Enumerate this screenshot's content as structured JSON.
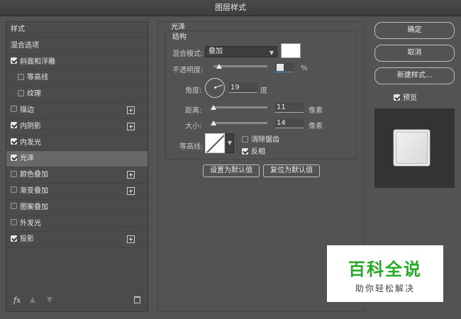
{
  "window": {
    "title": "图层样式"
  },
  "style_list": {
    "header": "样式",
    "items": [
      {
        "label": "混合选项",
        "checkbox": false,
        "has_checkbox": false,
        "plus": false,
        "indent": false,
        "selected": false
      },
      {
        "label": "斜面和浮雕",
        "checkbox": true,
        "has_checkbox": true,
        "plus": false,
        "indent": false,
        "selected": false
      },
      {
        "label": "等高线",
        "checkbox": false,
        "has_checkbox": true,
        "plus": false,
        "indent": true,
        "selected": false
      },
      {
        "label": "纹理",
        "checkbox": false,
        "has_checkbox": true,
        "plus": false,
        "indent": true,
        "selected": false
      },
      {
        "label": "描边",
        "checkbox": false,
        "has_checkbox": true,
        "plus": true,
        "indent": false,
        "selected": false
      },
      {
        "label": "内阴影",
        "checkbox": true,
        "has_checkbox": true,
        "plus": true,
        "indent": false,
        "selected": false
      },
      {
        "label": "内发光",
        "checkbox": true,
        "has_checkbox": true,
        "plus": false,
        "indent": false,
        "selected": false
      },
      {
        "label": "光泽",
        "checkbox": true,
        "has_checkbox": true,
        "plus": false,
        "indent": false,
        "selected": true
      },
      {
        "label": "颜色叠加",
        "checkbox": false,
        "has_checkbox": true,
        "plus": true,
        "indent": false,
        "selected": false
      },
      {
        "label": "渐变叠加",
        "checkbox": false,
        "has_checkbox": true,
        "plus": true,
        "indent": false,
        "selected": false
      },
      {
        "label": "图案叠加",
        "checkbox": false,
        "has_checkbox": true,
        "plus": false,
        "indent": false,
        "selected": false
      },
      {
        "label": "外发光",
        "checkbox": false,
        "has_checkbox": true,
        "plus": false,
        "indent": false,
        "selected": false
      },
      {
        "label": "投影",
        "checkbox": true,
        "has_checkbox": true,
        "plus": true,
        "indent": false,
        "selected": false
      }
    ],
    "footer": {
      "fx_label": "fx"
    }
  },
  "satin": {
    "section_title": "光泽",
    "structure_title": "结构",
    "blend_mode_label": "混合模式:",
    "blend_mode_value": "叠加",
    "blend_color": "#ffffff",
    "opacity_label": "不透明度:",
    "opacity_unit": "%",
    "angle_label": "角度:",
    "angle_value": "19",
    "angle_unit": "度",
    "distance_label": "距离:",
    "distance_value": "11",
    "distance_unit": "像素",
    "size_label": "大小:",
    "size_value": "14",
    "size_unit": "像素",
    "contour_label": "等高线:",
    "anti_alias_label": "消除锯齿",
    "anti_alias_checked": false,
    "invert_label": "反相",
    "invert_checked": true,
    "set_default_label": "设置为默认值",
    "reset_default_label": "复位为默认值"
  },
  "actions": {
    "ok_label": "确定",
    "cancel_label": "取消",
    "new_style_label": "新建样式...",
    "preview_label": "预览",
    "preview_checked": true
  },
  "watermark": {
    "title": "百科全说",
    "subtitle": "助你轻松解决"
  }
}
